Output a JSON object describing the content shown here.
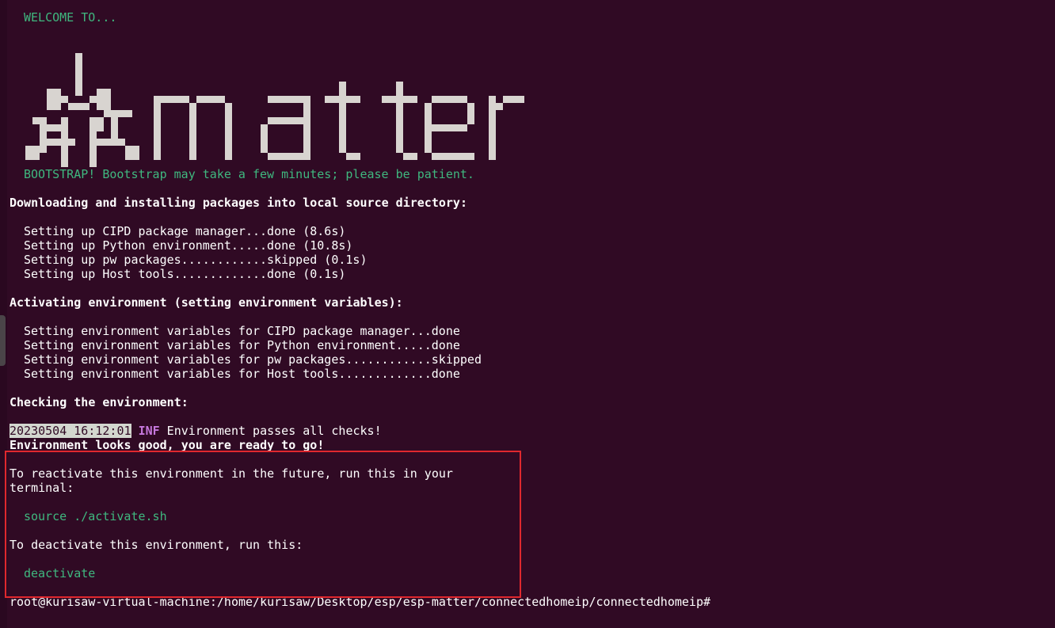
{
  "welcome": "WELCOME TO...",
  "logo_word": "matter",
  "bootstrap_msg": "BOOTSTRAP! Bootstrap may take a few minutes; please be patient.",
  "download_heading": "Downloading and installing packages into local source directory:",
  "setup_lines": [
    "Setting up CIPD package manager...done (8.6s)",
    "Setting up Python environment.....done (10.8s)",
    "Setting up pw packages............skipped (0.1s)",
    "Setting up Host tools.............done (0.1s)"
  ],
  "activate_heading": "Activating environment (setting environment variables):",
  "env_lines": [
    "Setting environment variables for CIPD package manager...done",
    "Setting environment variables for Python environment.....done",
    "Setting environment variables for pw packages............skipped",
    "Setting environment variables for Host tools.............done"
  ],
  "check_heading": "Checking the environment:",
  "check_log": {
    "timestamp": "20230504 16:12:01",
    "level": "INF",
    "message": " Environment passes all checks!"
  },
  "ready_msg": "Environment looks good, you are ready to go!",
  "reactivate_line1": "To reactivate this environment in the future, run this in your",
  "reactivate_line2": "terminal:",
  "reactivate_cmd": "source ./activate.sh",
  "deactivate_text": "To deactivate this environment, run this:",
  "deactivate_cmd": "deactivate",
  "prompt": "root@kurisaw-virtual-machine:/home/kurisaw/Desktop/esp/esp-matter/connectedhomeip/connectedhomeip#",
  "colors": {
    "background": "#300a24",
    "green_text": "#3fb87f",
    "highlight_border": "#e0282e",
    "logo": "#d8d4d0"
  }
}
